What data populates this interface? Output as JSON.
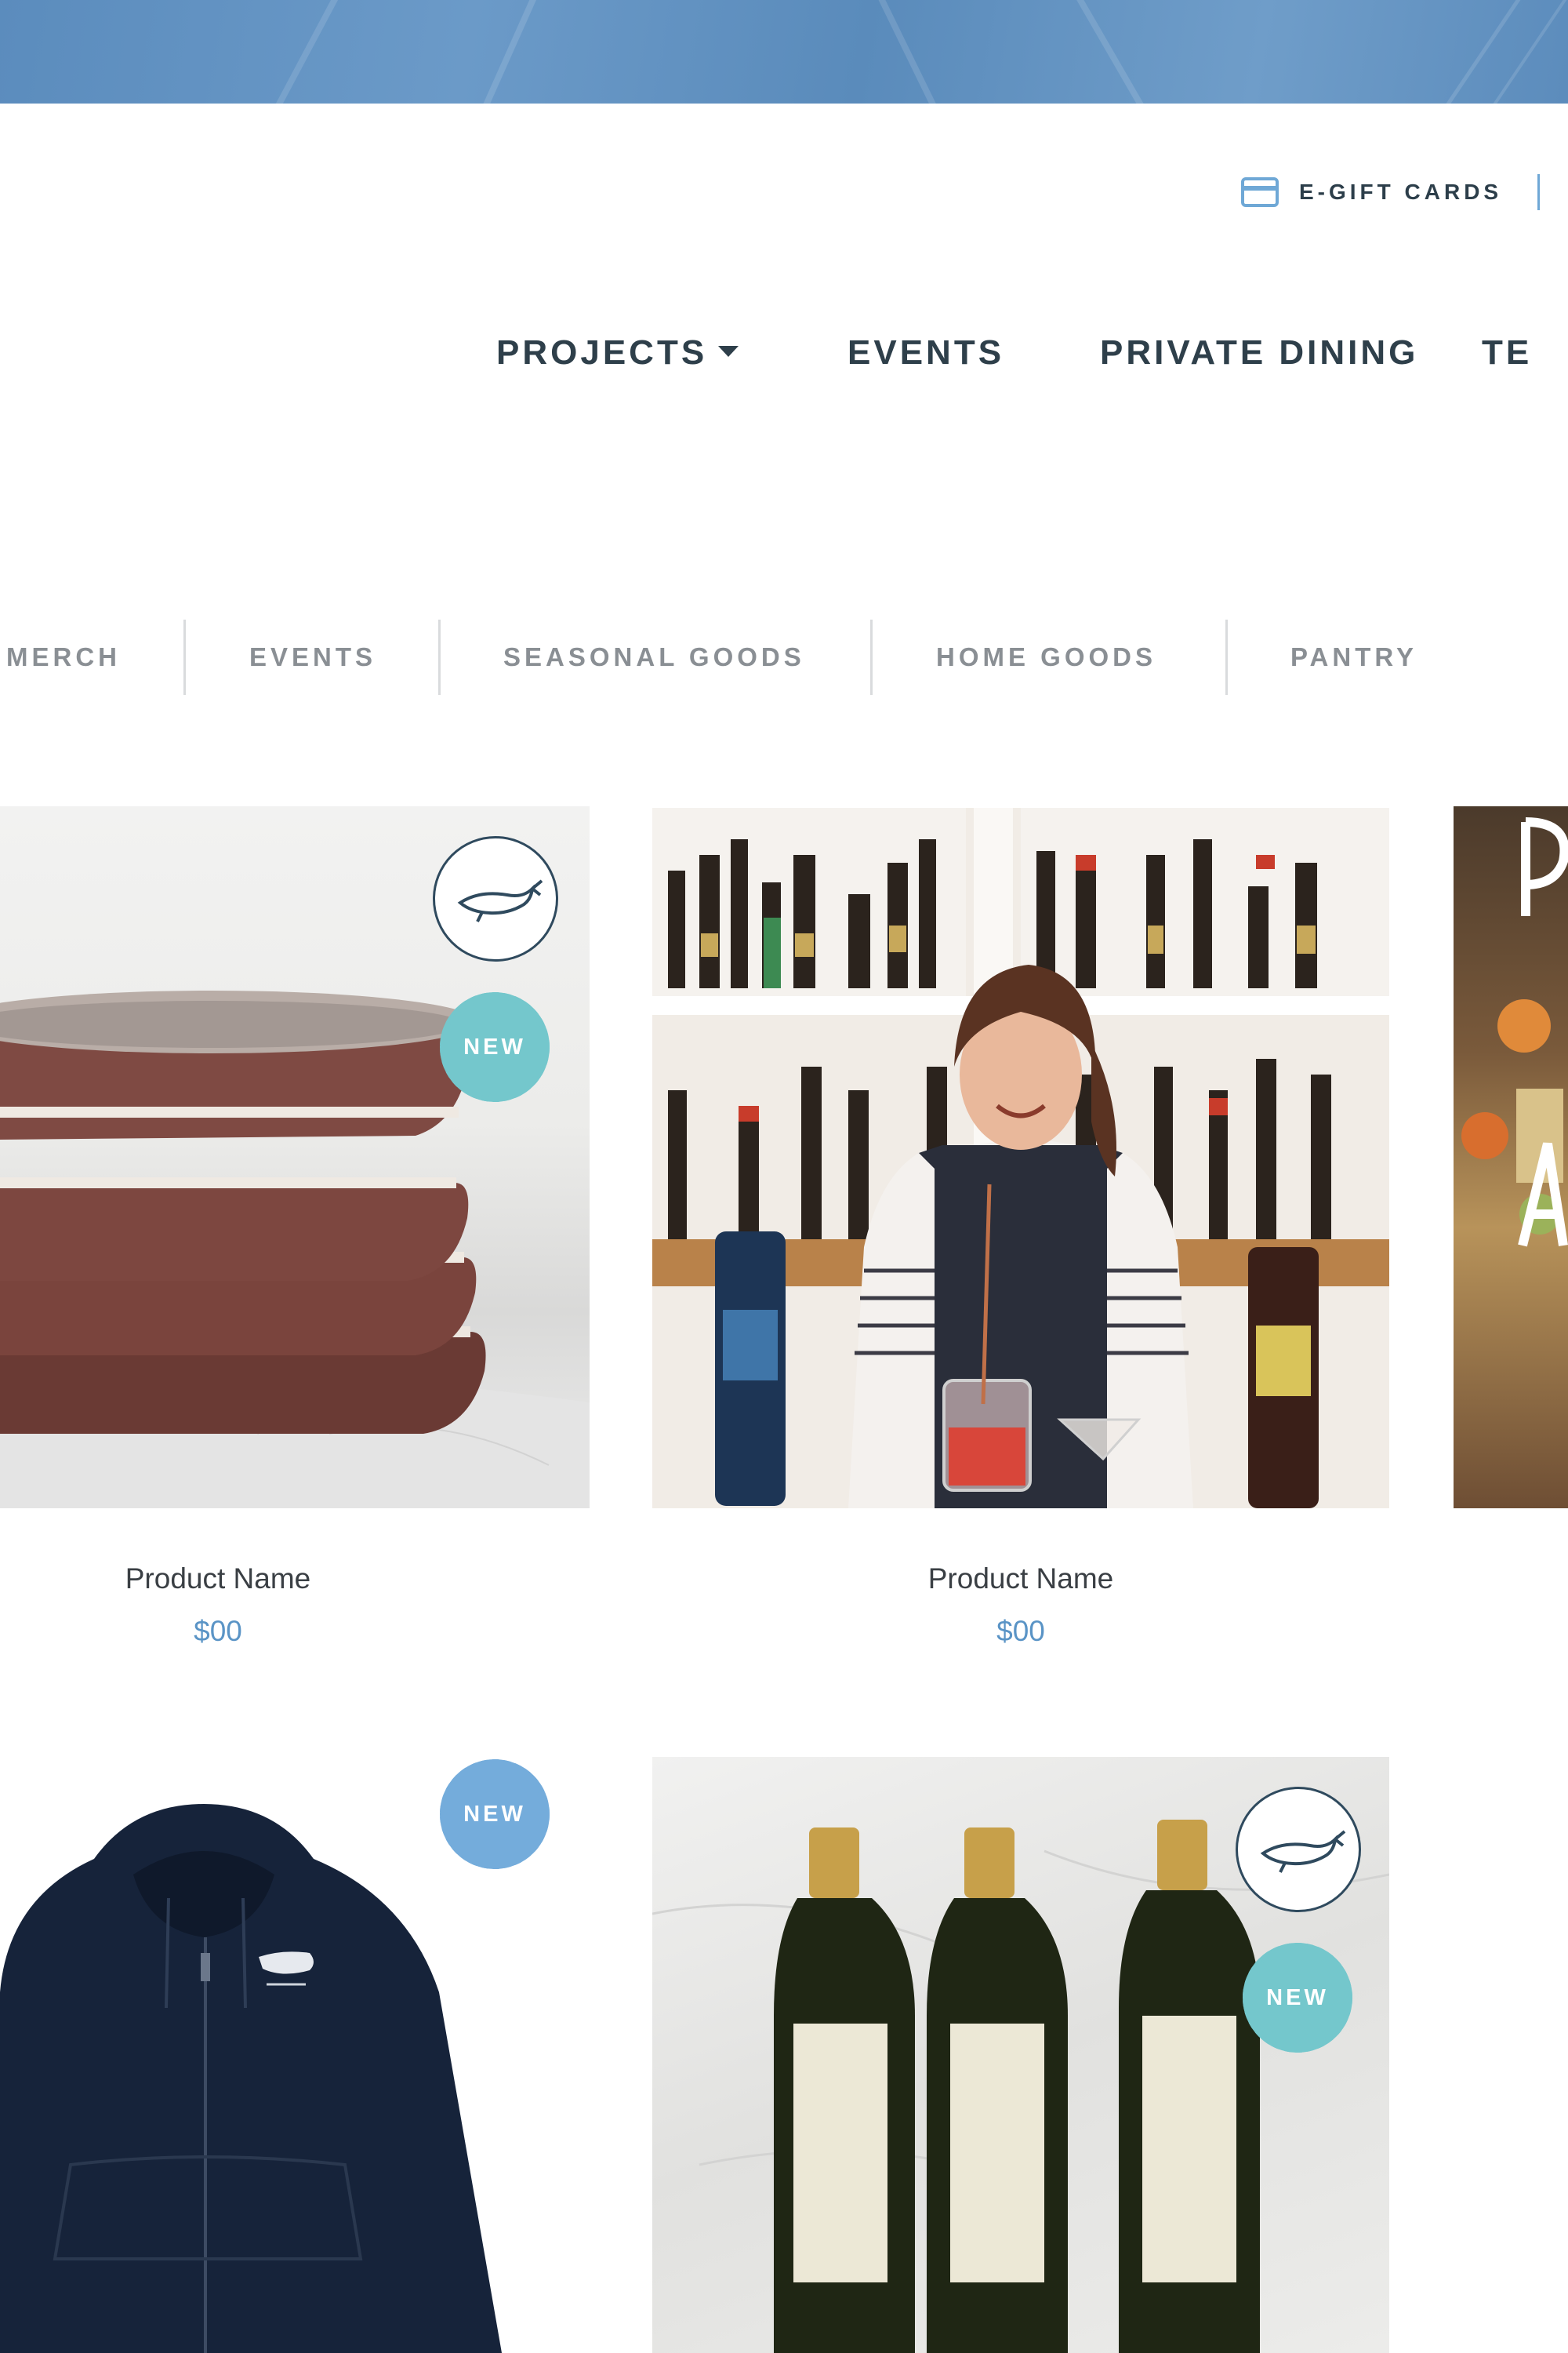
{
  "utility": {
    "gift_cards_label": "E-GIFT CARDS"
  },
  "main_nav": {
    "items": [
      {
        "label": "PROJECTS",
        "has_dropdown": true
      },
      {
        "label": "EVENTS"
      },
      {
        "label": "PRIVATE DINING"
      },
      {
        "label": "TE"
      }
    ]
  },
  "category_nav": {
    "items": [
      {
        "label": "MERCH"
      },
      {
        "label": "EVENTS"
      },
      {
        "label": "SEASONAL GOODS"
      },
      {
        "label": "HOME GOODS"
      },
      {
        "label": "PANTRY"
      }
    ]
  },
  "badges": {
    "new_label": "NEW"
  },
  "products": [
    {
      "name": "Product Name",
      "price": "$00",
      "image": "stacked ceramic bowls"
    },
    {
      "name": "Product Name",
      "price": "$00",
      "image": "bartender mixing cocktail"
    },
    {
      "image": "pasta dish with title lettering"
    },
    {
      "image": "navy zip hoodie"
    },
    {
      "image": "olive oil bottles"
    }
  ],
  "colors": {
    "hero": "#5f8fbf",
    "nav_text": "#2e3f4a",
    "category_text": "#8a8f94",
    "price": "#5a94c6",
    "badge_teal": "#74c7cc",
    "badge_blue": "#74acdb"
  }
}
